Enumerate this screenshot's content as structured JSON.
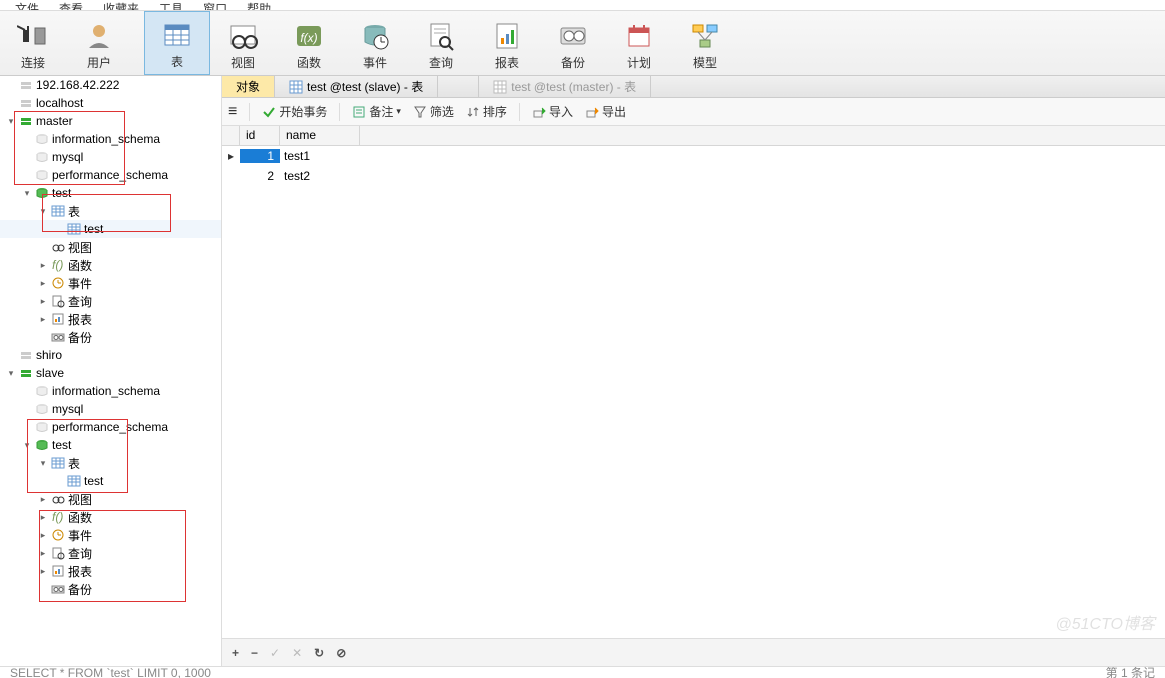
{
  "menu": [
    "文件",
    "查看",
    "收藏夹",
    "工具",
    "窗口",
    "帮助"
  ],
  "toolbar": [
    {
      "icon": "plug",
      "label": "连接"
    },
    {
      "icon": "user",
      "label": "用户"
    },
    {
      "icon": "table",
      "label": "表",
      "active": true
    },
    {
      "icon": "view",
      "label": "视图"
    },
    {
      "icon": "fx",
      "label": "函数"
    },
    {
      "icon": "event",
      "label": "事件"
    },
    {
      "icon": "query",
      "label": "查询"
    },
    {
      "icon": "report",
      "label": "报表"
    },
    {
      "icon": "backup",
      "label": "备份"
    },
    {
      "icon": "schedule",
      "label": "计划"
    },
    {
      "icon": "model",
      "label": "模型"
    }
  ],
  "tree": [
    {
      "d": 0,
      "a": "",
      "i": "conn-off",
      "l": "192.168.42.222"
    },
    {
      "d": 0,
      "a": "",
      "i": "conn-off",
      "l": "localhost"
    },
    {
      "d": 0,
      "a": "▾",
      "i": "conn-on",
      "l": "master"
    },
    {
      "d": 1,
      "a": "",
      "i": "db-off",
      "l": "information_schema"
    },
    {
      "d": 1,
      "a": "",
      "i": "db-off",
      "l": "mysql"
    },
    {
      "d": 1,
      "a": "",
      "i": "db-off",
      "l": "performance_schema"
    },
    {
      "d": 1,
      "a": "▾",
      "i": "db-on",
      "l": "test"
    },
    {
      "d": 2,
      "a": "▾",
      "i": "tbl",
      "l": "表"
    },
    {
      "d": 3,
      "a": "",
      "i": "tbl",
      "l": "test",
      "sel": true
    },
    {
      "d": 2,
      "a": "",
      "i": "view",
      "l": "视图"
    },
    {
      "d": 2,
      "a": "▸",
      "i": "fx",
      "l": "函数"
    },
    {
      "d": 2,
      "a": "▸",
      "i": "event",
      "l": "事件"
    },
    {
      "d": 2,
      "a": "▸",
      "i": "query",
      "l": "查询"
    },
    {
      "d": 2,
      "a": "▸",
      "i": "report",
      "l": "报表"
    },
    {
      "d": 2,
      "a": "",
      "i": "backup",
      "l": "备份"
    },
    {
      "d": 0,
      "a": "",
      "i": "conn-off",
      "l": "shiro"
    },
    {
      "d": 0,
      "a": "▾",
      "i": "conn-on",
      "l": "slave"
    },
    {
      "d": 1,
      "a": "",
      "i": "db-off",
      "l": "information_schema"
    },
    {
      "d": 1,
      "a": "",
      "i": "db-off",
      "l": "mysql"
    },
    {
      "d": 1,
      "a": "",
      "i": "db-off",
      "l": "performance_schema"
    },
    {
      "d": 1,
      "a": "▾",
      "i": "db-on",
      "l": "test"
    },
    {
      "d": 2,
      "a": "▾",
      "i": "tbl",
      "l": "表"
    },
    {
      "d": 3,
      "a": "",
      "i": "tbl",
      "l": "test"
    },
    {
      "d": 2,
      "a": "▸",
      "i": "view",
      "l": "视图"
    },
    {
      "d": 2,
      "a": "▸",
      "i": "fx",
      "l": "函数"
    },
    {
      "d": 2,
      "a": "▸",
      "i": "event",
      "l": "事件"
    },
    {
      "d": 2,
      "a": "▸",
      "i": "query",
      "l": "查询"
    },
    {
      "d": 2,
      "a": "▸",
      "i": "report",
      "l": "报表"
    },
    {
      "d": 2,
      "a": "",
      "i": "backup",
      "l": "备份"
    }
  ],
  "tabs": {
    "objects": "对象",
    "slave": "test @test (slave) - 表",
    "master": "test @test (master) - 表"
  },
  "subtoolbar": {
    "menu": "≡",
    "begin": "开始事务",
    "memo": "备注",
    "filter": "筛选",
    "sort": "排序",
    "import": "导入",
    "export": "导出"
  },
  "grid": {
    "headers": {
      "id": "id",
      "name": "name"
    },
    "rows": [
      {
        "id": "1",
        "name": "test1",
        "sel": true,
        "marker": "▸"
      },
      {
        "id": "2",
        "name": "test2",
        "sel": false,
        "marker": ""
      }
    ]
  },
  "bottom": {
    "plus": "+",
    "minus": "−",
    "check": "✓",
    "x": "✕",
    "refresh": "↻",
    "stop": "⊘"
  },
  "status": {
    "sql": "SELECT * FROM `test` LIMIT 0, 1000",
    "rec": "第 1 条记"
  },
  "watermark": "@51CTO博客"
}
